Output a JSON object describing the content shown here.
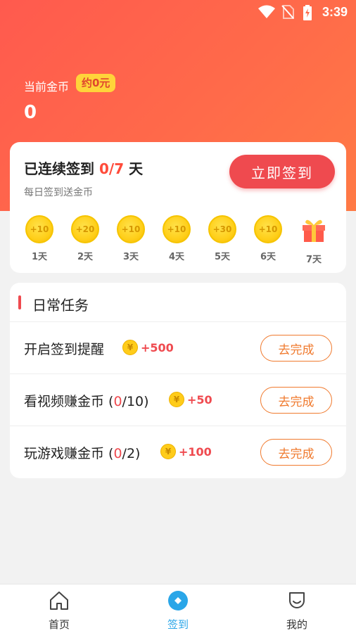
{
  "status_bar": {
    "time": "3:39"
  },
  "balance": {
    "label": "当前金币",
    "badge": "约0元",
    "value": "0"
  },
  "signin": {
    "title_prefix": "已连续签到 ",
    "streak": "0/7",
    "title_suffix": " 天",
    "subtitle": "每日签到送金币",
    "button": "立即签到",
    "days": [
      {
        "reward": "+10",
        "label": "1天"
      },
      {
        "reward": "+20",
        "label": "2天"
      },
      {
        "reward": "+10",
        "label": "3天"
      },
      {
        "reward": "+10",
        "label": "4天"
      },
      {
        "reward": "+30",
        "label": "5天"
      },
      {
        "reward": "+10",
        "label": "6天"
      },
      {
        "reward": "gift-icon",
        "label": "7天"
      }
    ]
  },
  "tasks": {
    "title": "日常任务",
    "items": [
      {
        "name": "开启签到提醒",
        "progress_done": "",
        "progress_total": "",
        "reward": "+500",
        "button": "去完成"
      },
      {
        "name": "看视频赚金币 (",
        "progress_done": "0",
        "progress_total": "/10)",
        "reward": "+50",
        "button": "去完成"
      },
      {
        "name": "玩游戏赚金币 (",
        "progress_done": "0",
        "progress_total": "/2)",
        "reward": "+100",
        "button": "去完成"
      }
    ],
    "coin_symbol": "¥"
  },
  "tabbar": {
    "items": [
      {
        "label": "首页",
        "icon": "home-icon"
      },
      {
        "label": "签到",
        "icon": "signin-icon",
        "active": true
      },
      {
        "label": "我的",
        "icon": "profile-icon"
      }
    ]
  },
  "colors": {
    "accent": "#ef4a4f",
    "header": "#ff5a4e",
    "tab_active": "#2aa6e8",
    "task_button": "#f07a2e"
  }
}
